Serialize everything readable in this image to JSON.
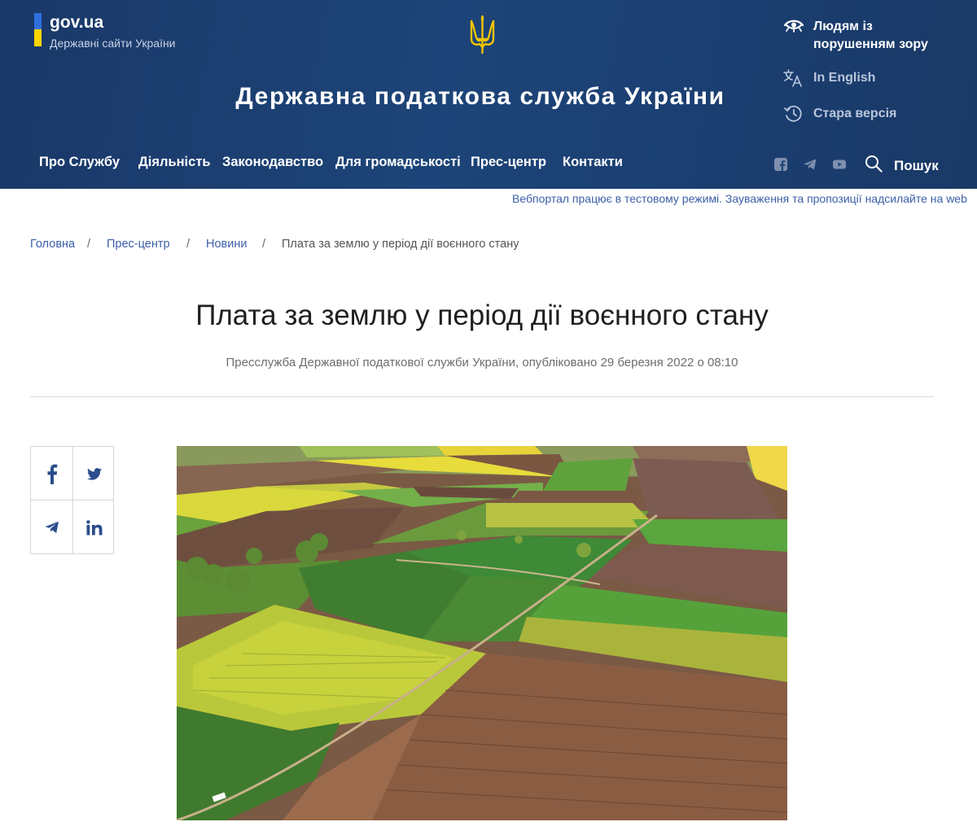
{
  "gov": {
    "name": "gov.ua",
    "subtitle": "Державні сайти України"
  },
  "site": {
    "title": "Державна податкова служба України"
  },
  "utilities": {
    "vision_line1": "Людям із",
    "vision_line2": "порушенням зору",
    "language": "In English",
    "old_version": "Стара версія"
  },
  "nav": {
    "items": [
      "Про Службу",
      "Діяльність",
      "Законодавство",
      "Для громадськості",
      "Прес-центр",
      "Контакти"
    ],
    "search_label": "Пошук"
  },
  "icons": {
    "vision": "eye-icon",
    "language": "translate-icon",
    "old_version": "history-icon",
    "social": [
      "facebook-icon",
      "telegram-icon",
      "youtube-icon"
    ],
    "search": "search-icon",
    "share": [
      "facebook-icon",
      "twitter-icon",
      "telegram-icon",
      "linkedin-icon"
    ]
  },
  "notice": "Вебпортал працює в тестовому режимі. Зауваження та пропозиції надсилайте на web",
  "breadcrumb": {
    "items": [
      "Головна",
      "Прес-центр",
      "Новини"
    ],
    "current": "Плата за землю у період дії воєнного стану",
    "separator": "/"
  },
  "article": {
    "title": "Плата за землю у період дії воєнного стану",
    "meta": "Пресслужба Державної податкової служби України, опубліковано 29 березня 2022 о 08:10"
  },
  "colors": {
    "header_bg": "#1d4478",
    "link": "#3b5ea8",
    "flag_blue": "#2f6fe0",
    "flag_yellow": "#ffd500",
    "share_icon": "#2b4d8c"
  }
}
